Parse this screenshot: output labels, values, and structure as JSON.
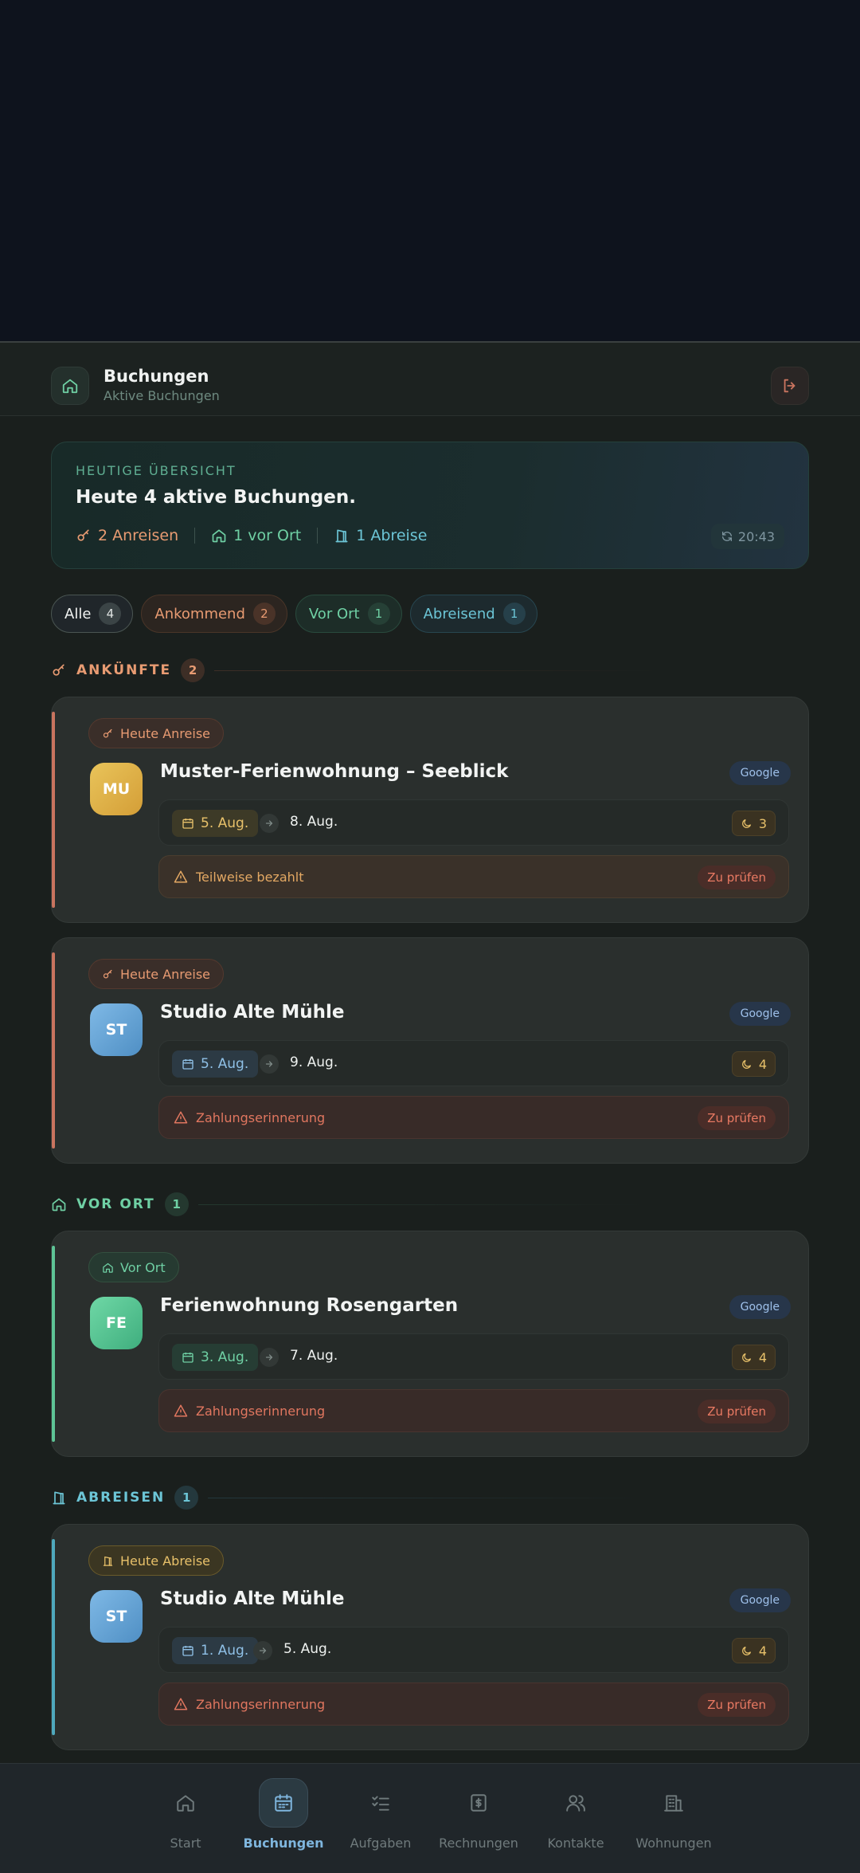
{
  "header": {
    "title": "Buchungen",
    "subtitle": "Aktive Buchungen"
  },
  "overview": {
    "kicker": "HEUTIGE ÜBERSICHT",
    "title": "Heute 4 aktive Buchungen.",
    "arrivals": "2 Anreisen",
    "onsite": "1 vor Ort",
    "departures": "1 Abreise",
    "time": "20:43"
  },
  "filters": [
    {
      "label": "Alle",
      "count": "4"
    },
    {
      "label": "Ankommend",
      "count": "2"
    },
    {
      "label": "Vor Ort",
      "count": "1"
    },
    {
      "label": "Abreisend",
      "count": "1"
    }
  ],
  "sections": {
    "arrivals": {
      "label": "ANKÜNFTE",
      "count": "2"
    },
    "onsite": {
      "label": "VOR ORT",
      "count": "1"
    },
    "departures": {
      "label": "ABREISEN",
      "count": "1"
    }
  },
  "bookings": [
    {
      "tag": "Heute Anreise",
      "initials": "MU",
      "title": "Muster-Ferienwohnung – Seeblick",
      "source": "Google",
      "from": "5. Aug.",
      "to": "8. Aug.",
      "nights": "3",
      "warning": "Teilweise bezahlt",
      "action": "Zu prüfen"
    },
    {
      "tag": "Heute Anreise",
      "initials": "ST",
      "title": "Studio Alte Mühle",
      "source": "Google",
      "from": "5. Aug.",
      "to": "9. Aug.",
      "nights": "4",
      "warning": "Zahlungserinnerung",
      "action": "Zu prüfen"
    },
    {
      "tag": "Vor Ort",
      "initials": "FE",
      "title": "Ferienwohnung Rosengarten",
      "source": "Google",
      "from": "3. Aug.",
      "to": "7. Aug.",
      "nights": "4",
      "warning": "Zahlungserinnerung",
      "action": "Zu prüfen"
    },
    {
      "tag": "Heute Abreise",
      "initials": "ST",
      "title": "Studio Alte Mühle",
      "source": "Google",
      "from": "1. Aug.",
      "to": "5. Aug.",
      "nights": "4",
      "warning": "Zahlungserinnerung",
      "action": "Zu prüfen"
    }
  ],
  "nav": [
    {
      "label": "Start",
      "icon": "home-icon"
    },
    {
      "label": "Buchungen",
      "icon": "calendar-icon"
    },
    {
      "label": "Aufgaben",
      "icon": "checklist-icon"
    },
    {
      "label": "Rechnungen",
      "icon": "invoice-icon"
    },
    {
      "label": "Kontakte",
      "icon": "users-icon"
    },
    {
      "label": "Wohnungen",
      "icon": "building-icon"
    }
  ],
  "colors": {
    "accent_green": "#6fd0a4",
    "accent_orange": "#e89b72",
    "accent_teal": "#6cc5d6",
    "accent_blue": "#7fb6de",
    "warning_red": "#ea7a63",
    "warning_yellow": "#e8c16a"
  }
}
